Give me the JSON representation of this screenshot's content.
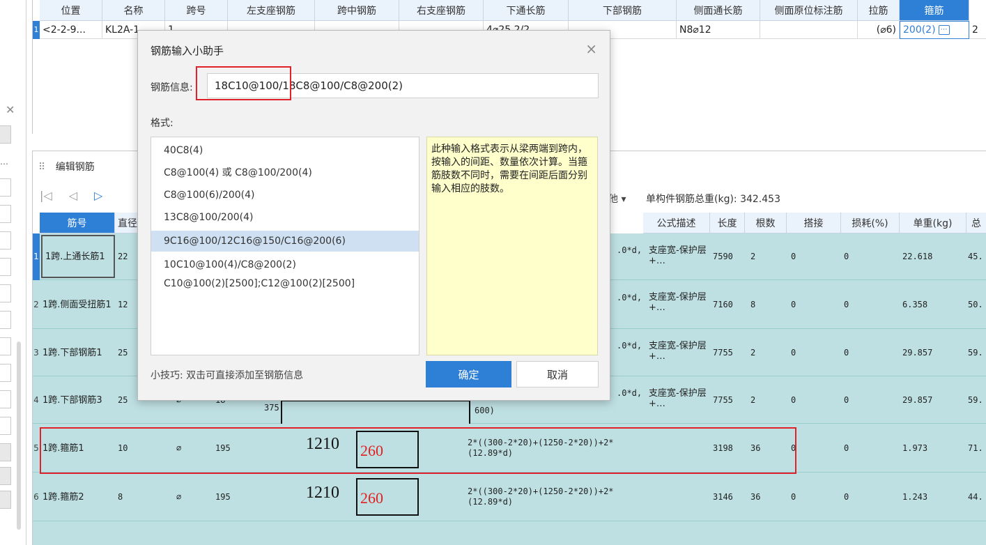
{
  "top_table": {
    "headers": [
      "位置",
      "名称",
      "跨号",
      "左支座钢筋",
      "跨中钢筋",
      "右支座钢筋",
      "下通长筋",
      "下部钢筋",
      "侧面通长筋",
      "侧面原位标注筋",
      "拉筋",
      "箍筋"
    ],
    "row": {
      "num": "1",
      "position": "<2-2-9...",
      "name": "KL2A-1",
      "span": "1",
      "bottom_through": "4⌀25 2/2",
      "side_through": "N8⌀12",
      "tie": "(⌀6)",
      "stirrup": "200(2)",
      "stirrup_btn": "⋯",
      "extra": "2"
    }
  },
  "edit_panel": {
    "title": "编辑钢筋",
    "other_label": "他 ▾",
    "total_weight_label": "单构件钢筋总重(kg): 342.453",
    "headers": [
      "筋号",
      "直径",
      "",
      "",
      "",
      "",
      "",
      "公式描述",
      "长度",
      "根数",
      "搭接",
      "损耗(%)",
      "单重(kg)",
      "总"
    ],
    "rows": [
      {
        "num": "1",
        "name": "1跨.上通长筋1",
        "dia": "22",
        "formula_tail": ".0*d,",
        "desc": "支座宽-保护层+…",
        "length": "7590",
        "count": "2",
        "lap": "0",
        "loss": "0",
        "unit_weight": "22.618",
        "total": "45."
      },
      {
        "num": "2",
        "name": "1跨.侧面受扭筋1",
        "dia": "12",
        "formula_tail": ".0*d,",
        "desc": "支座宽-保护层+…",
        "length": "7160",
        "count": "8",
        "lap": "0",
        "loss": "0",
        "unit_weight": "6.358",
        "total": "50."
      },
      {
        "num": "3",
        "name": "1跨.下部钢筋1",
        "dia": "25",
        "formula_tail": ".0*d,",
        "desc": "支座宽-保护层+…",
        "length": "7755",
        "count": "2",
        "lap": "0",
        "loss": "0",
        "unit_weight": "29.857",
        "total": "59."
      },
      {
        "num": "4",
        "name": "1跨.下部钢筋3",
        "dia": "25",
        "grade": "⌀",
        "code": "18",
        "shape_num": "375",
        "formula": "600)",
        "formula_tail": ".0*d,",
        "desc": "支座宽-保护层+…",
        "length": "7755",
        "count": "2",
        "lap": "0",
        "loss": "0",
        "unit_weight": "29.857",
        "total": "59."
      },
      {
        "num": "5",
        "name": "1跨.箍筋1",
        "dia": "10",
        "grade": "⌀",
        "code": "195",
        "shape_num": "1210",
        "shape_red": "260",
        "formula": "2*((300-2*20)+(1250-2*20))+2*(12.89*d)",
        "desc": "",
        "length": "3198",
        "count": "36",
        "lap": "0",
        "loss": "0",
        "unit_weight": "1.973",
        "total": "71."
      },
      {
        "num": "6",
        "name": "1跨.箍筋2",
        "dia": "8",
        "grade": "⌀",
        "code": "195",
        "shape_num": "1210",
        "shape_red": "260",
        "formula": "2*((300-2*20)+(1250-2*20))+2*(12.89*d)",
        "desc": "",
        "length": "3146",
        "count": "36",
        "lap": "0",
        "loss": "0",
        "unit_weight": "1.243",
        "total": "44."
      }
    ]
  },
  "dialog": {
    "title": "钢筋输入小助手",
    "close": "×",
    "info_label": "钢筋信息:",
    "info_value": "18C10@100/18C8@100/C8@200(2)",
    "format_label": "格式:",
    "formats": [
      "40C8(4)",
      "C8@100(4) 或 C8@100/200(4)",
      "C8@100(6)/200(4)",
      "13C8@100/200(4)",
      "9C16@100/12C16@150/C16@200(6)",
      "10C10@100(4)/C8@200(2)",
      "C10@100(2)[2500];C12@100(2)[2500]"
    ],
    "selected_index": 4,
    "tip": "此种输入格式表示从梁两端到跨内，按输入的间距、数量依次计算。当箍筋肢数不同时，需要在间距后面分别输入相应的肢数。",
    "hint": "小技巧: 双击可直接添加至钢筋信息",
    "ok": "确定",
    "cancel": "取消"
  },
  "colors": {
    "accent": "#2e7fd6",
    "row_bg": "#bfe0e3",
    "highlight_red": "#e0202a",
    "tip_bg": "#ffffcc"
  }
}
